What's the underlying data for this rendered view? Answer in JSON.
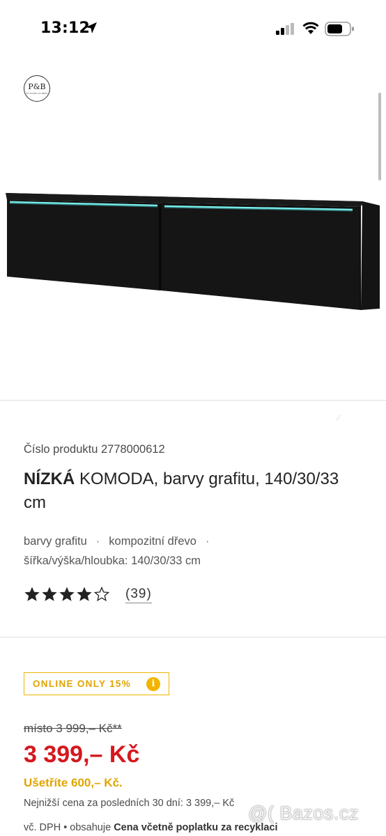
{
  "status_bar": {
    "time": "13:12",
    "icons": [
      "location-arrow-icon",
      "cellular-signal-icon",
      "wifi-icon",
      "battery-icon"
    ]
  },
  "product_image": {
    "logo_text": "P&B",
    "logo_subtext": "BY PLANET OF BEDS"
  },
  "product": {
    "sku_line": "Číslo produktu 2778000612",
    "title_bold": "NÍZKÁ",
    "title_rest": " KOMODA, barvy grafitu, 140/30/33 cm",
    "attributes": [
      "barvy grafitu",
      "kompozitní dřevo"
    ],
    "attribute_separator": "·",
    "dimensions": "šířka/výška/hloubka: 140/30/33 cm",
    "rating_stars_filled": 4,
    "rating_stars_total": 5,
    "rating_count": "(39)"
  },
  "pricing": {
    "badge_label": "ONLINE ONLY 15%",
    "badge_info": "i",
    "old_price": "místo 3 999,– Kč**",
    "price": "3 399,– Kč",
    "savings": "Ušetříte 600,– Kč.",
    "lowest_price": "Nejnižší cena za posledních 30 dní: 3 399,– Kč",
    "vat_prefix": "vč. DPH • obsahuje",
    "vat_bold": "Cena včetně poplatku za recyklaci"
  },
  "watermark": "@( Bazos.cz",
  "colors": {
    "price_red": "#d4181f",
    "accent_yellow": "#f0b400",
    "led_cyan": "#7ff6f4"
  }
}
